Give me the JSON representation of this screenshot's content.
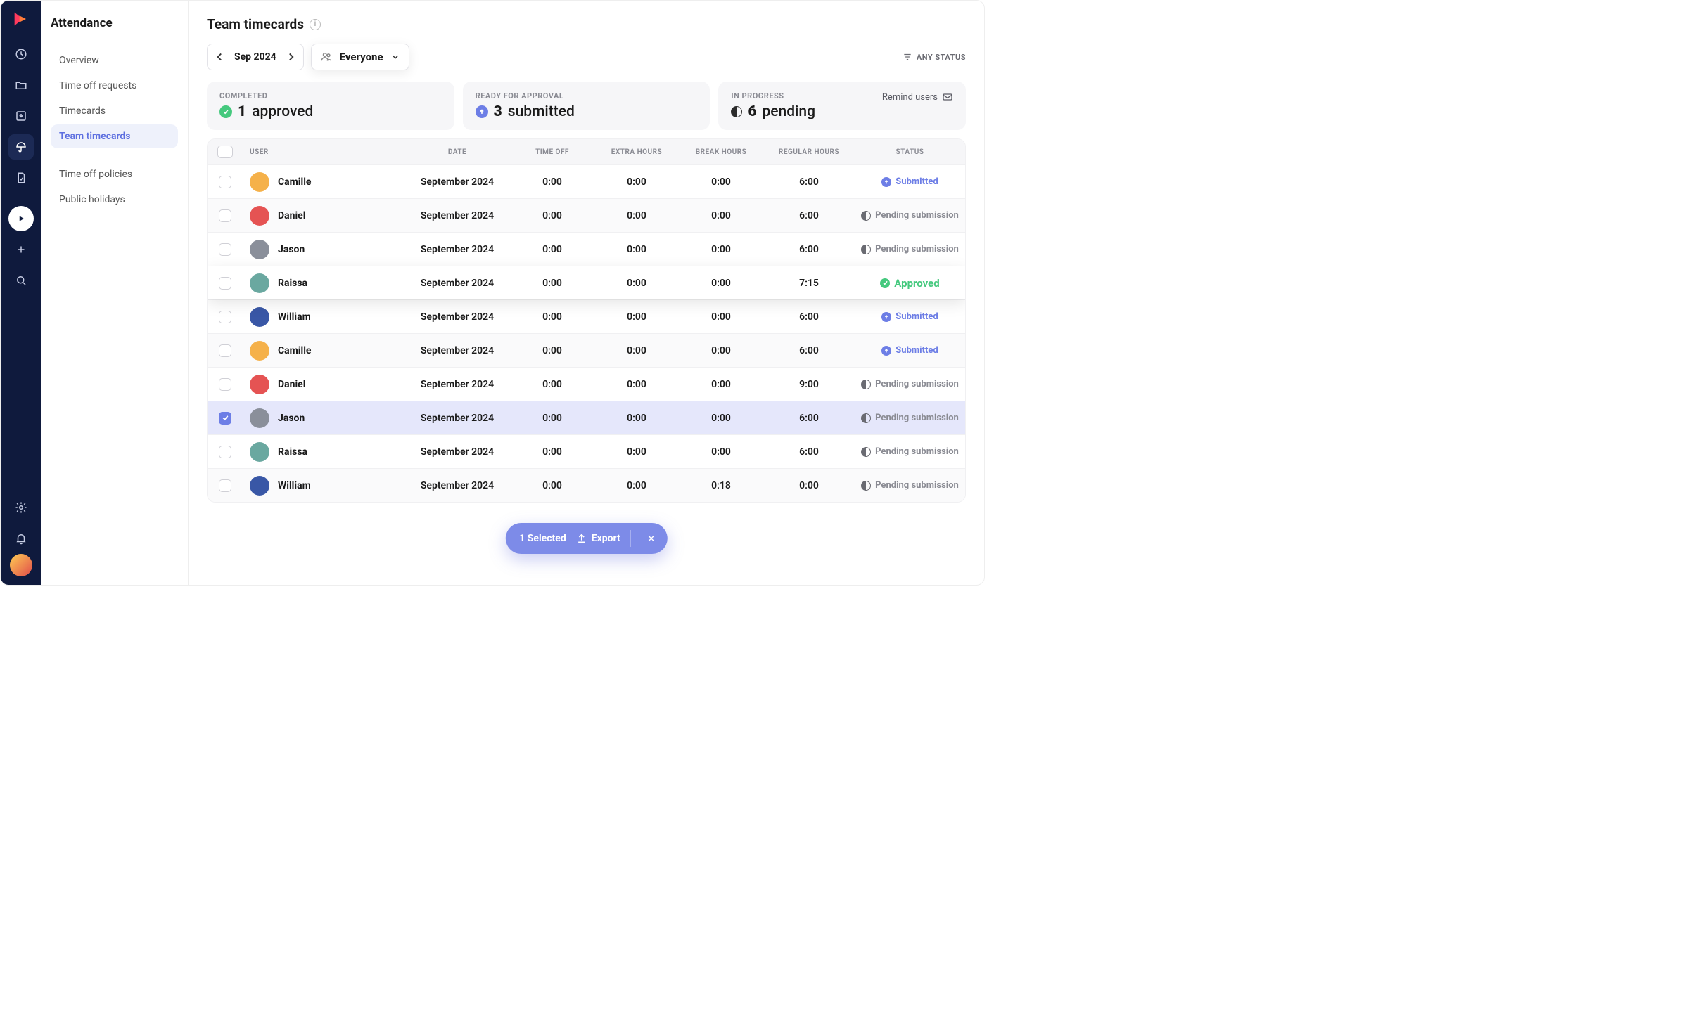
{
  "sidebar": {
    "title": "Attendance",
    "items": [
      {
        "label": "Overview",
        "active": false
      },
      {
        "label": "Time off requests",
        "active": false
      },
      {
        "label": "Timecards",
        "active": false
      },
      {
        "label": "Team timecards",
        "active": true
      }
    ],
    "secondary": [
      {
        "label": "Time off policies"
      },
      {
        "label": "Public holidays"
      }
    ]
  },
  "header": {
    "title": "Team timecards",
    "month": "Sep 2024",
    "scope": "Everyone",
    "any_status": "ANY STATUS"
  },
  "summary": {
    "completed": {
      "label": "COMPLETED",
      "count": "1",
      "word": "approved"
    },
    "ready": {
      "label": "READY FOR APPROVAL",
      "count": "3",
      "word": "submitted"
    },
    "progress": {
      "label": "IN PROGRESS",
      "count": "6",
      "word": "pending",
      "remind": "Remind users"
    }
  },
  "table": {
    "headers": {
      "user": "USER",
      "date": "DATE",
      "timeoff": "TIME OFF",
      "extra": "EXTRA HOURS",
      "break": "BREAK HOURS",
      "regular": "REGULAR HOURS",
      "status": "STATUS"
    },
    "rows": [
      {
        "name": "Camille",
        "date": "September 2024",
        "timeoff": "0:00",
        "extra": "0:00",
        "break": "0:00",
        "regular": "6:00",
        "status": "submitted",
        "av": "#f5b14a"
      },
      {
        "name": "Daniel",
        "date": "September 2024",
        "timeoff": "0:00",
        "extra": "0:00",
        "break": "0:00",
        "regular": "6:00",
        "status": "pending",
        "av": "#e55353"
      },
      {
        "name": "Jason",
        "date": "September 2024",
        "timeoff": "0:00",
        "extra": "0:00",
        "break": "0:00",
        "regular": "6:00",
        "status": "pending",
        "av": "#8a8f9a"
      },
      {
        "name": "Raissa",
        "date": "September 2024",
        "timeoff": "0:00",
        "extra": "0:00",
        "break": "0:00",
        "regular": "7:15",
        "status": "approved",
        "av": "#6aa8a0",
        "highlight": true
      },
      {
        "name": "William",
        "date": "September 2024",
        "timeoff": "0:00",
        "extra": "0:00",
        "break": "0:00",
        "regular": "6:00",
        "status": "submitted",
        "av": "#3957a6"
      },
      {
        "name": "Camille",
        "date": "September 2024",
        "timeoff": "0:00",
        "extra": "0:00",
        "break": "0:00",
        "regular": "6:00",
        "status": "submitted",
        "av": "#f5b14a"
      },
      {
        "name": "Daniel",
        "date": "September 2024",
        "timeoff": "0:00",
        "extra": "0:00",
        "break": "0:00",
        "regular": "9:00",
        "status": "pending",
        "av": "#e55353"
      },
      {
        "name": "Jason",
        "date": "September 2024",
        "timeoff": "0:00",
        "extra": "0:00",
        "break": "0:00",
        "regular": "6:00",
        "status": "pending",
        "av": "#8a8f9a",
        "selected": true
      },
      {
        "name": "Raissa",
        "date": "September 2024",
        "timeoff": "0:00",
        "extra": "0:00",
        "break": "0:00",
        "regular": "6:00",
        "status": "pending",
        "av": "#6aa8a0"
      },
      {
        "name": "William",
        "date": "September 2024",
        "timeoff": "0:00",
        "extra": "0:00",
        "break": "0:18",
        "regular": "0:00",
        "status": "pending",
        "av": "#3957a6"
      }
    ],
    "status_labels": {
      "submitted": "Submitted",
      "pending": "Pending submission",
      "approved": "Approved"
    }
  },
  "pill": {
    "selected": "1 Selected",
    "export": "Export"
  }
}
